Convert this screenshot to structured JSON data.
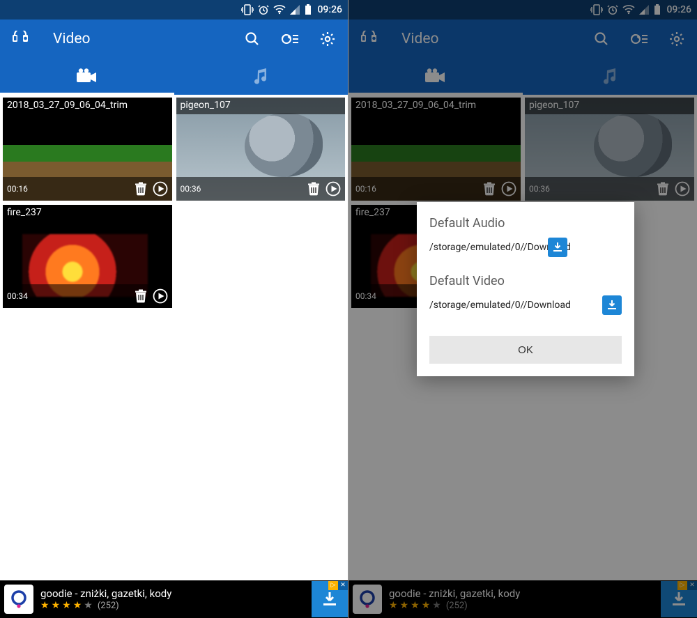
{
  "statusbar": {
    "time": "09:26"
  },
  "appbar": {
    "title": "Video"
  },
  "videos": [
    {
      "name": "2018_03_27_09_06_04_trim",
      "duration": "00:16",
      "thumb": "green"
    },
    {
      "name": "pigeon_107",
      "duration": "00:36",
      "thumb": "pigeon"
    },
    {
      "name": "fire_237",
      "duration": "00:34",
      "thumb": "fire"
    }
  ],
  "ad": {
    "title": "goodie - zniżki, gazetki, kody",
    "rating_count": "(252)",
    "badge_ad": "▷",
    "badge_close": "✕"
  },
  "dialog": {
    "heading_audio": "Default Audio",
    "path_audio": "/storage/emulated/0//Download",
    "heading_video": "Default Video",
    "path_video": "/storage/emulated/0//Download",
    "ok": "OK"
  }
}
